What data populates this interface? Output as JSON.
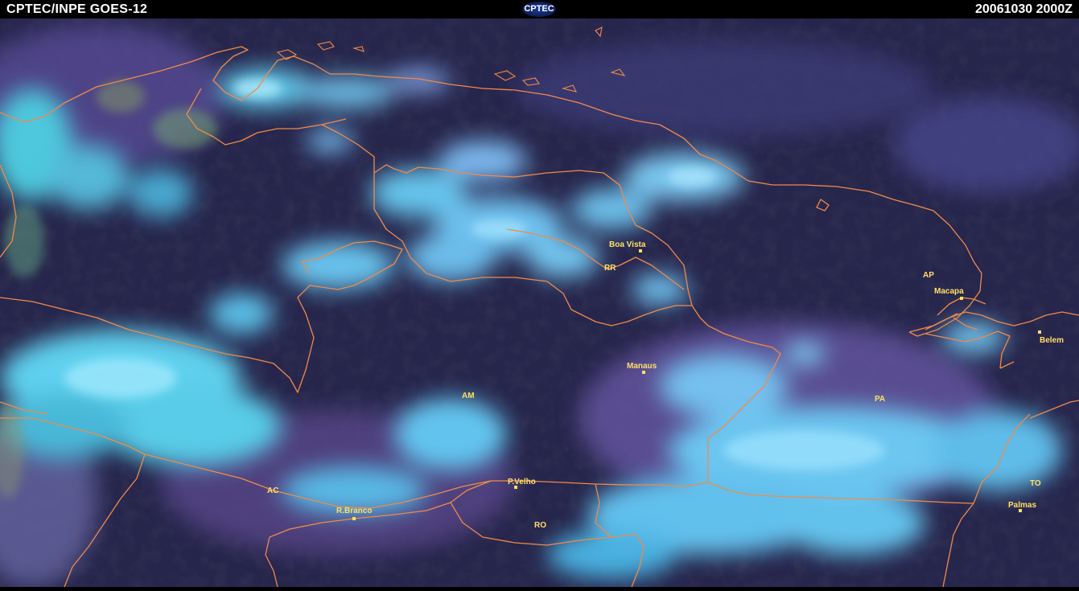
{
  "header": {
    "title_left": "CPTEC/INPE  GOES-12",
    "logo_text": "CPTEC",
    "timestamp": "20061030  2000Z"
  },
  "map": {
    "boundary_color": "#f08a4a",
    "label_color": "#ffe066",
    "cities": [
      {
        "name": "Boa Vista"
      },
      {
        "name": "Macapa"
      },
      {
        "name": "Belem"
      },
      {
        "name": "Manaus"
      },
      {
        "name": "P.Velho"
      },
      {
        "name": "R.Branco"
      },
      {
        "name": "Palmas"
      }
    ],
    "states": [
      {
        "code": "RR"
      },
      {
        "code": "AP"
      },
      {
        "code": "AM"
      },
      {
        "code": "PA"
      },
      {
        "code": "AC"
      },
      {
        "code": "RO"
      },
      {
        "code": "TO"
      }
    ]
  }
}
